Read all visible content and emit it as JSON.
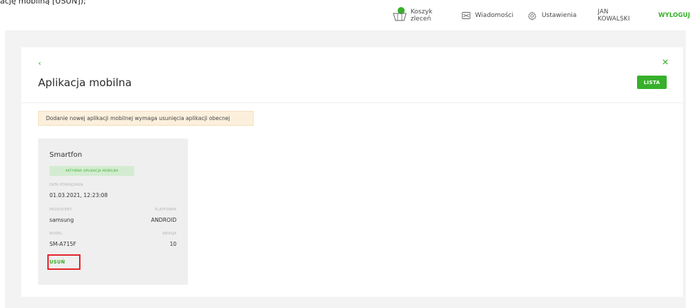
{
  "caption_fragment": "ację mobilną [USUŃ]);",
  "topnav": {
    "cart_label": "Koszyk zleceń",
    "messages_label": "Wiadomości",
    "settings_label": "Ustawienia",
    "user_name": "JAN KOWALSKI",
    "logout_label": "WYLOGUJ"
  },
  "page": {
    "back_glyph": "‹",
    "close_glyph": "✕",
    "title": "Aplikacja mobilna",
    "list_button": "LISTA",
    "notice": "Dodanie nowej aplikacji mobilnej wymaga usunięcia aplikacji obecnej"
  },
  "device": {
    "name": "Smartfon",
    "status": "AKTYWNA APLIKACJA MOBILNA",
    "paired_date_label": "DATA POWIĄZANIA",
    "paired_date": "01.03.2021, 12:23:08",
    "manufacturer_label": "PRODUCENT",
    "manufacturer": "samsung",
    "platform_label": "PLATFORMA",
    "platform": "ANDROID",
    "model_label": "MODEL",
    "model": "SM-A715F",
    "version_label": "WERSJA",
    "version": "10",
    "remove_label": "USUŃ"
  },
  "colors": {
    "accent": "#37b02b",
    "highlight_border": "#e3262b",
    "notice_bg": "#fcf0dd",
    "status_bg": "#d3ecd1"
  },
  "icons": [
    "cart-icon",
    "mail-icon",
    "gear-icon",
    "back-arrow-icon",
    "close-icon"
  ]
}
